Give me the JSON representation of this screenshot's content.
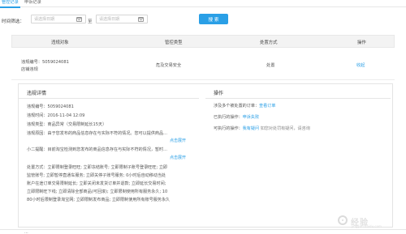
{
  "tabs": [
    {
      "label": "管控记录",
      "active": true
    },
    {
      "label": "申诉记录",
      "active": false
    }
  ],
  "filter": {
    "label": "时间筛选：",
    "start_placeholder": "请选择日期",
    "to_label": "至",
    "end_placeholder": "请选择日期",
    "search_label": "搜 索"
  },
  "table": {
    "headers": [
      "违规对象",
      "管控类型",
      "处置方式",
      "操作"
    ],
    "rows": [
      {
        "object_line1": "违规编号：5059024081",
        "object_line2": "店铺违规",
        "type": "危及交易安全",
        "action": "处置",
        "operation": "收起"
      }
    ]
  },
  "detail": {
    "title": "违规详情",
    "lines": [
      "违规编号：5059024081",
      "违规时间：2016-11-04 12:09",
      "违规类型：商品异常（交易限制延长15天）",
      "违规原因：由于您发布的商品信息存在与实际不符的情况。您可以提供商品..."
    ],
    "more1": "点击展开",
    "reminder": "小二提醒：目前淘宝检测到您发布的商品信息存在与实际不符的情况，暂时...",
    "more2": "点击展开",
    "penalty_lines": [
      "处置方式：立即限制登录旺旺; 立即冻结账号; 立即限制子账号登录旺旺; 立即",
      "监管账号; 立即暂停直通车服务; 立即关停子账号服务; 0小时后自动移动当处",
      "账户在途订单交易限制延长; 立即关闭未发货订单并退款; 立即延长交易时间;",
      "立即限制旺下线; 立即清除全部商品(可回滚); 立即限制使用所有服务永久; 10",
      "80小时后限制登录淘宝网; 立即限制发布商品; 立即限制使用所有账号服务永久"
    ]
  },
  "operations": {
    "title": "操作",
    "line1_label": "涉及多个被处置的订单：",
    "line1_link": "查看订单",
    "line2_label": "已执行的操作：",
    "line2_link": "申诉失败",
    "line3_label": "可执行的操作：",
    "line3_link": "我有疑问",
    "line3_rest": "如您对处罚有疑问，请咨询"
  },
  "colors": {
    "accent": "#2a9fe6",
    "header_bg": "#f3f3f3"
  },
  "watermark": {
    "text": "经验",
    "sub": "jingyan.baidu.com"
  },
  "bottom": {
    "text": "..."
  }
}
